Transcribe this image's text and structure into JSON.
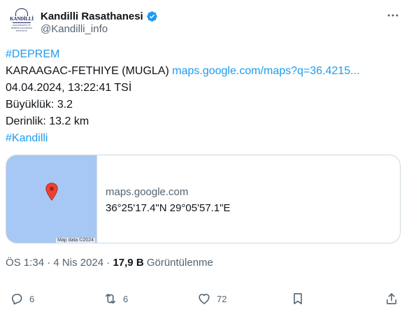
{
  "author": {
    "display_name": "Kandilli Rasathanesi",
    "handle": "@Kandilli_info",
    "avatar_text": "KANDİLLİ",
    "avatar_subtext": "RASATHANESİ VE DEPREM ARAŞTIRMA ENSTİTÜSÜ",
    "verified_color": "#1d9bf0"
  },
  "tweet": {
    "hashtag_top": "#DEPREM",
    "location": "KARAAGAC-FETHIYE (MUGLA)",
    "map_link": "maps.google.com/maps?q=36.4215...",
    "datetime": "04.04.2024, 13:22:41 TSİ",
    "magnitude": "Büyüklük: 3.2",
    "depth": "Derinlik: 13.2 km",
    "hashtag_bottom": "#Kandilli"
  },
  "card": {
    "domain": "maps.google.com",
    "title": "36°25'17.4\"N 29°05'57.1\"E",
    "map_credit": "Map data ©2024"
  },
  "meta": {
    "time": "ÖS 1:34",
    "separator": "·",
    "date": "4 Nis 2024",
    "views_count": "17,9 B",
    "views_label": "Görüntülenme"
  },
  "actions": {
    "replies": "6",
    "reposts": "6",
    "likes": "72"
  },
  "colors": {
    "link": "#1d9bf0",
    "secondary_text": "#536471",
    "map_water": "#a7c8f4",
    "pin": "#ea4335"
  }
}
